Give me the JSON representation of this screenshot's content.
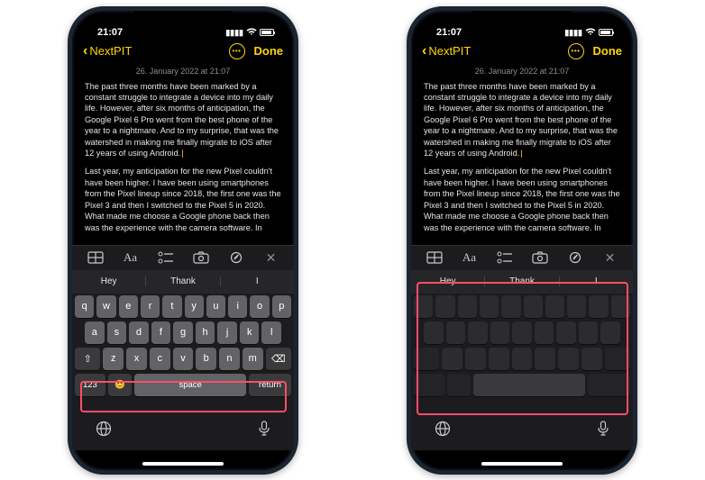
{
  "status": {
    "time": "21:07"
  },
  "nav": {
    "back": "NextPIT",
    "done": "Done"
  },
  "note": {
    "timestamp": "26. January 2022 at 21:07",
    "p1": "The past three months have been marked by a constant struggle to integrate a device into my daily life. However, after six months of anticipation, the Google Pixel 6 Pro went from the best phone of the year to a nightmare. And to my surprise, that was the watershed in making me finally migrate to iOS after 12 years of using Android.",
    "p2": "Last year, my anticipation for the new Pixel couldn't have been higher. I have been using smartphones from the Pixel lineup since 2018, the first one was the Pixel 3 and then I switched to the Pixel 5 in 2020. What made me choose a Google phone back then was the experience with the camera software. In"
  },
  "toolbar": {
    "aa": "Aa"
  },
  "suggest": [
    "Hey",
    "Thank",
    "I"
  ],
  "keys": {
    "r1": [
      "q",
      "w",
      "e",
      "r",
      "t",
      "y",
      "u",
      "i",
      "o",
      "p"
    ],
    "r2": [
      "a",
      "s",
      "d",
      "f",
      "g",
      "h",
      "j",
      "k",
      "l"
    ],
    "r3": [
      "z",
      "x",
      "c",
      "v",
      "b",
      "n",
      "m"
    ],
    "shift": "⇧",
    "del": "⌫",
    "num": "123",
    "emoji": "😊",
    "space": "space",
    "ret": "return"
  },
  "bottom": {
    "globe": "🌐",
    "mic": "🎤"
  }
}
